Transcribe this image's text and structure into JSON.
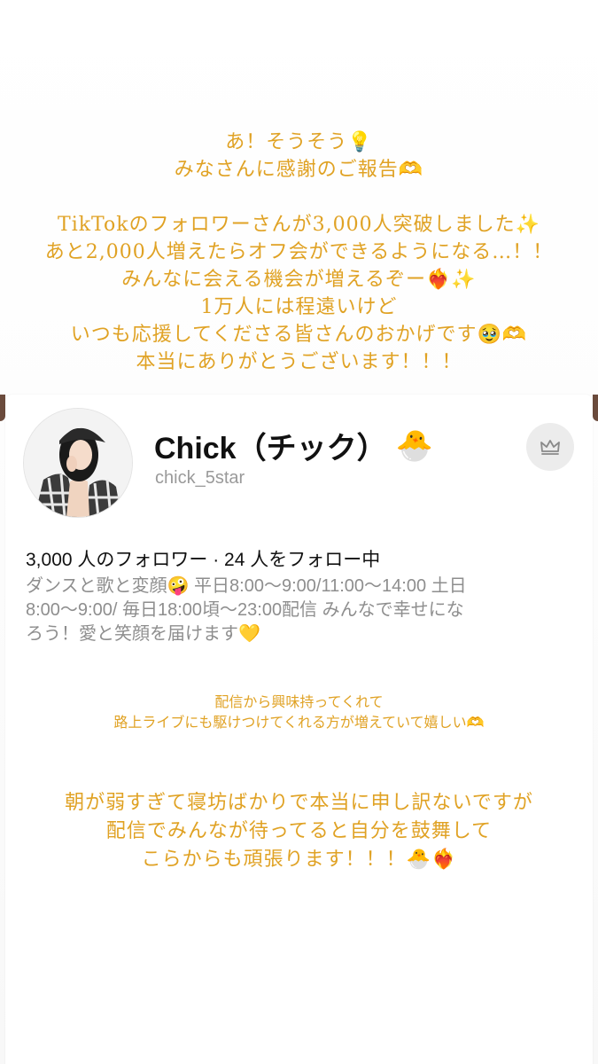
{
  "story": {
    "top_message": {
      "lines_a": [
        "あ！そうそう💡",
        "みなさんに感謝のご報告🫶"
      ],
      "lines_b": [
        "TikTokのフォロワーさんが3,000人突破しました✨",
        "あと2,000人増えたらオフ会ができるようになる…！！",
        "みんなに会える機会が増えるぞー❤️‍🔥✨",
        "1万人には程遠いけど",
        "いつも応援してくださる皆さんのおかげです🥹🫶",
        "本当にありがとうございます！！！"
      ]
    },
    "middle_message": {
      "lines": [
        "配信から興味持ってくれて",
        "路上ライブにも駆けつけてくれる方が増えていて嬉しい🫶"
      ]
    },
    "bottom_message": {
      "lines": [
        "朝が弱すぎて寝坊ばかりで本当に申し訳ないですが",
        "配信でみんなが待ってると自分を鼓舞して",
        "こらからも頑張ります！！！🐣❤️‍🔥"
      ]
    },
    "text_color": "#e0a224"
  },
  "profile": {
    "display_name": "Chick（チック）",
    "name_emoji": "🐣",
    "username": "chick_5star",
    "follow_stats": "3,000 人のフォロワー · 24 人をフォロー中",
    "bio_lines": [
      "ダンスと歌と変顔🤪 平日8:00〜9:00/11:00〜14:00 土日",
      "8:00〜9:00/ 毎日18:00頃〜23:00配信 みんなで幸せにな",
      "ろう！愛と笑顔を届けます💛"
    ],
    "icons": {
      "crown_button": "crown-icon",
      "avatar": "avatar"
    }
  }
}
